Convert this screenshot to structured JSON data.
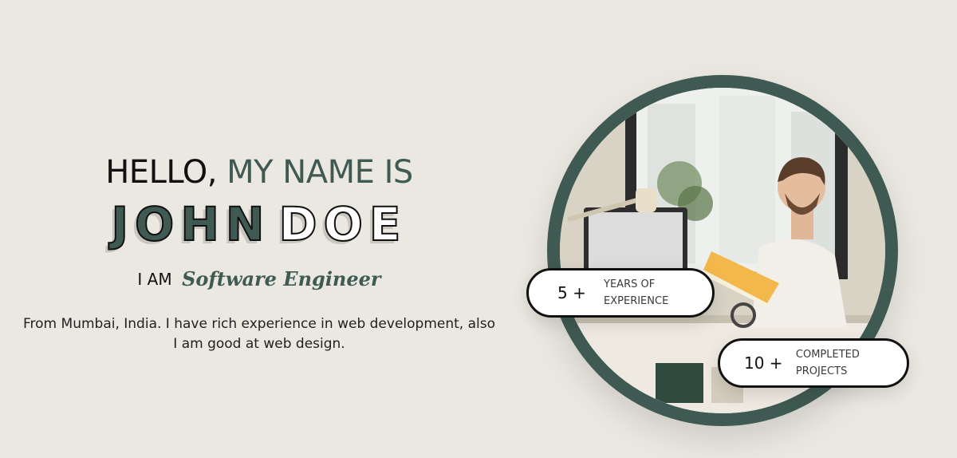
{
  "intro": {
    "greeting": "HELLO,",
    "greeting_accent": "MY NAME IS",
    "first_name": "JOHN",
    "last_name": "DOE",
    "role_prefix": "I AM",
    "role": "Software Engineer",
    "bio": "From Mumbai, India. I have rich experience in web development, also I am good at web design."
  },
  "stats": [
    {
      "value": "5 +",
      "label_line1": "YEARS OF",
      "label_line2": "EXPERIENCE"
    },
    {
      "value": "10 +",
      "label_line1": "COMPLETED",
      "label_line2": "PROJECTS"
    }
  ],
  "colors": {
    "background": "#ebe8e1",
    "accent": "#3f5a52",
    "text": "#111111"
  }
}
